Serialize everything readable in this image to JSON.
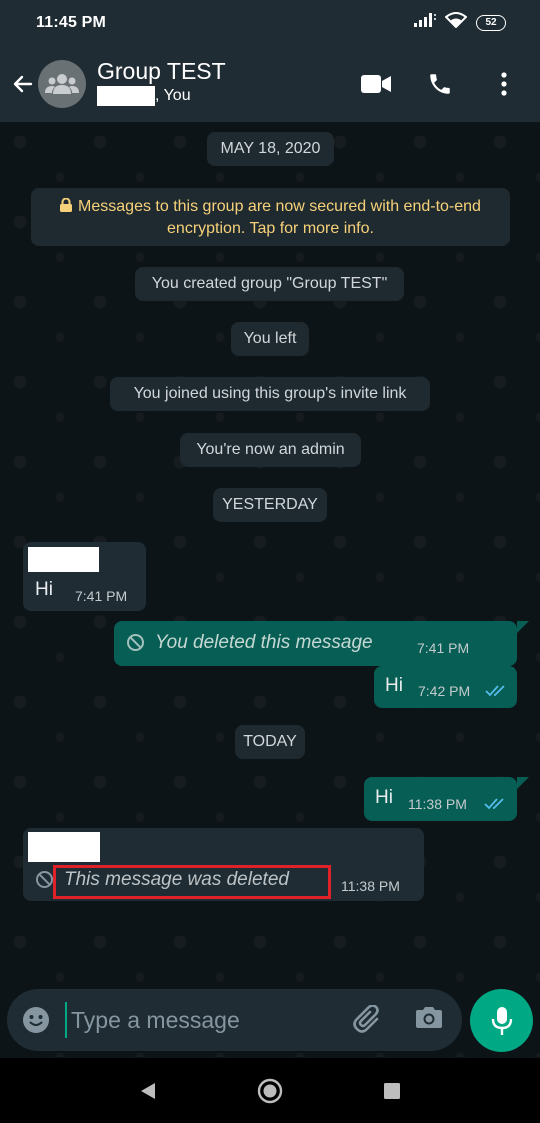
{
  "status_bar": {
    "time": "11:45 PM",
    "battery": "52"
  },
  "header": {
    "title": "Group TEST",
    "subtitle_suffix": ", You"
  },
  "chat": {
    "date_may": "MAY 18, 2020",
    "encryption_notice": "Messages to this group are now secured with end-to-end encryption. Tap for more info.",
    "system_created": "You created group \"Group TEST\"",
    "system_left": "You left",
    "system_joined": "You joined using this group's invite link",
    "system_admin": "You're now an admin",
    "date_yesterday": "YESTERDAY",
    "date_today": "TODAY",
    "messages": [
      {
        "direction": "incoming",
        "text": "Hi",
        "time": "7:41 PM"
      },
      {
        "direction": "outgoing",
        "text": "You deleted this message",
        "time": "7:41 PM",
        "deleted": true
      },
      {
        "direction": "outgoing",
        "text": "Hi",
        "time": "7:42 PM"
      },
      {
        "direction": "outgoing",
        "text": "Hi",
        "time": "11:38 PM"
      },
      {
        "direction": "incoming",
        "text": "This message was deleted",
        "time": "11:38 PM",
        "deleted": true
      }
    ]
  },
  "composer": {
    "placeholder": "Type a message"
  },
  "colors": {
    "header_bg": "#1f2c33",
    "outgoing_bubble": "#075e54",
    "incoming_bubble": "#1f2c33",
    "accent": "#00a884",
    "read_ticks": "#53bdeb",
    "highlight": "#e0212a",
    "encryption_text": "#f7d179"
  },
  "icons": {
    "header": [
      "back-arrow-icon",
      "group-avatar-icon",
      "video-call-icon",
      "voice-call-icon",
      "more-vert-icon"
    ],
    "composer": [
      "emoji-icon",
      "attach-icon",
      "camera-icon",
      "mic-icon"
    ],
    "nav": [
      "back-nav-icon",
      "home-nav-icon",
      "recents-nav-icon"
    ]
  }
}
